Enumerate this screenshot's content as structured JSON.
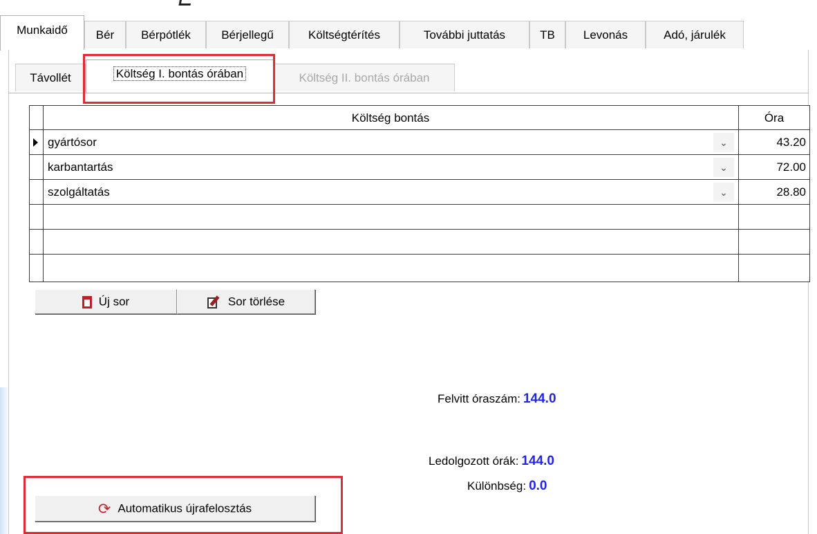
{
  "main_tabs": [
    {
      "label": "Munkaidő",
      "active": true
    },
    {
      "label": "Bér"
    },
    {
      "label": "Bérpótlék"
    },
    {
      "label": "Bérjellegű"
    },
    {
      "label": "Költségtérítés"
    },
    {
      "label": "További juttatás"
    },
    {
      "label": "TB"
    },
    {
      "label": "Levonás"
    },
    {
      "label": "Adó, járulék"
    }
  ],
  "sub_tabs": [
    {
      "label": "Távollét"
    },
    {
      "label": "Költség I. bontás órában",
      "active": true
    },
    {
      "label": "Költség II. bontás órában",
      "disabled": true
    }
  ],
  "grid": {
    "headers": {
      "category": "Költség bontás",
      "hours": "Óra"
    },
    "rows": [
      {
        "category": "gyártósor",
        "hours": "43.20",
        "current": true
      },
      {
        "category": "karbantartás",
        "hours": "72.00"
      },
      {
        "category": "szolgáltatás",
        "hours": "28.80"
      },
      {
        "category": "",
        "hours": ""
      },
      {
        "category": "",
        "hours": ""
      },
      {
        "category": "",
        "hours": ""
      }
    ]
  },
  "buttons": {
    "new_row": "Új sor",
    "delete_row": "Sor törlése",
    "auto_realloc": "Automatikus újrafelosztás"
  },
  "summary": {
    "entered_label": "Felvitt óraszám:",
    "entered_value": "144.0",
    "worked_label": "Ledolgozott órák:",
    "worked_value": "144.0",
    "diff_label": "Különbség:",
    "diff_value": "0.0"
  },
  "colors": {
    "highlight": "#e12b33",
    "value_blue": "#1f24e8",
    "icon_red": "#b5222a"
  },
  "icons": {
    "new_row": "document-icon",
    "delete_row": "delete-document-icon",
    "auto_realloc": "refresh-icon",
    "dropdown": "chevron-down-icon"
  }
}
